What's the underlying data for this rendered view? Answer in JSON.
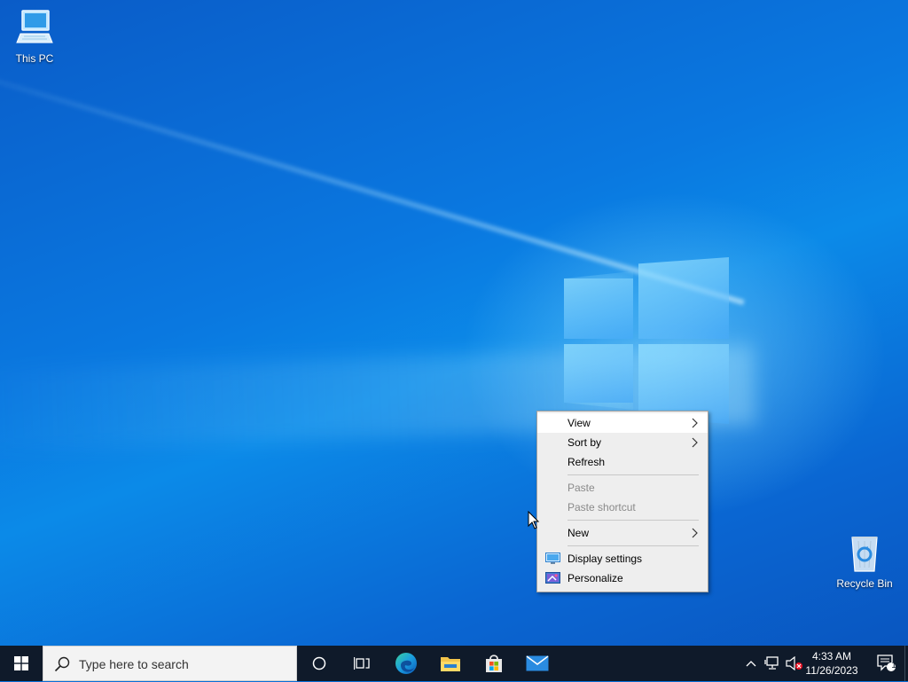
{
  "desktop": {
    "icons": [
      {
        "label": "This PC",
        "icon": "computer-icon"
      },
      {
        "label": "Recycle Bin",
        "icon": "recycle-bin-icon"
      }
    ],
    "wallpaper": {
      "primary": "#0a6fd8",
      "glow": "#8cdcff"
    }
  },
  "context_menu": {
    "items": [
      {
        "label": "View",
        "submenu": true,
        "highlighted": true,
        "disabled": false
      },
      {
        "label": "Sort by",
        "submenu": true,
        "highlighted": false,
        "disabled": false
      },
      {
        "label": "Refresh",
        "submenu": false,
        "highlighted": false,
        "disabled": false
      },
      {
        "label": "Paste",
        "submenu": false,
        "highlighted": false,
        "disabled": true
      },
      {
        "label": "Paste shortcut",
        "submenu": false,
        "highlighted": false,
        "disabled": true
      },
      {
        "label": "New",
        "submenu": true,
        "highlighted": false,
        "disabled": false
      },
      {
        "label": "Display settings",
        "submenu": false,
        "highlighted": false,
        "disabled": false,
        "icon": "display-icon"
      },
      {
        "label": "Personalize",
        "submenu": false,
        "highlighted": false,
        "disabled": false,
        "icon": "personalize-icon"
      }
    ]
  },
  "taskbar": {
    "search_placeholder": "Type here to search",
    "pinned": [
      "cortana-icon",
      "task-view-icon",
      "edge-icon",
      "file-explorer-icon",
      "store-icon",
      "mail-icon"
    ],
    "clock": {
      "time": "4:33 AM",
      "date": "11/26/2023"
    },
    "notification_count": "1",
    "background": "#0f1a2a"
  }
}
